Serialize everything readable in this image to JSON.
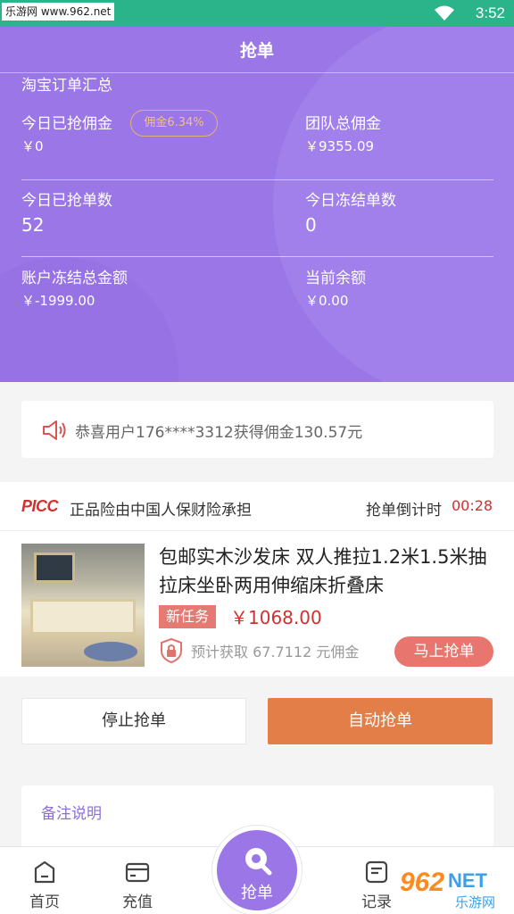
{
  "status_bar": {
    "watermark": "乐游网 www.962.net",
    "time": "3:52"
  },
  "header": {
    "title": "抢单",
    "section_title": "淘宝订单汇总",
    "stats": [
      {
        "label": "今日已抢佣金",
        "value": "￥0"
      },
      {
        "label": "团队总佣金",
        "value": "￥9355.09"
      },
      {
        "label": "今日已抢单数",
        "value": "52"
      },
      {
        "label": "今日冻结单数",
        "value": "0"
      },
      {
        "label": "账户冻结总金额",
        "value": "￥-1999.00"
      },
      {
        "label": "当前余额",
        "value": "￥0.00"
      }
    ],
    "commission_pill": "佣金6.34%",
    "colors": {
      "background": "#9b76e6",
      "pill": "#e6b07a"
    }
  },
  "notice": {
    "icon": "speaker-icon",
    "text": "恭喜用户176****3312获得佣金130.57元"
  },
  "order": {
    "insurer_logo": "PICC",
    "insurance_text": "正品险由中国人保财险承担",
    "countdown_label": "抢单倒计时",
    "countdown_value": "00:28",
    "product_title": "包邮实木沙发床 双人推拉1.2米1.5米抽拉床坐卧两用伸缩床折叠床",
    "tag": "新任务",
    "price": "￥1068.00",
    "estimate": "预计获取 67.7112 元佣金",
    "grab_button": "马上抢单"
  },
  "actions": {
    "stop": "停止抢单",
    "auto": "自动抢单",
    "auto_color": "#e47e49"
  },
  "remarks": {
    "label": "备注说明"
  },
  "tabbar": {
    "home": "首页",
    "recharge": "充值",
    "grab": "抢单",
    "records": "记录"
  },
  "watermark_logo": {
    "main": "962",
    "net": "NET",
    "sub": "乐游网"
  }
}
